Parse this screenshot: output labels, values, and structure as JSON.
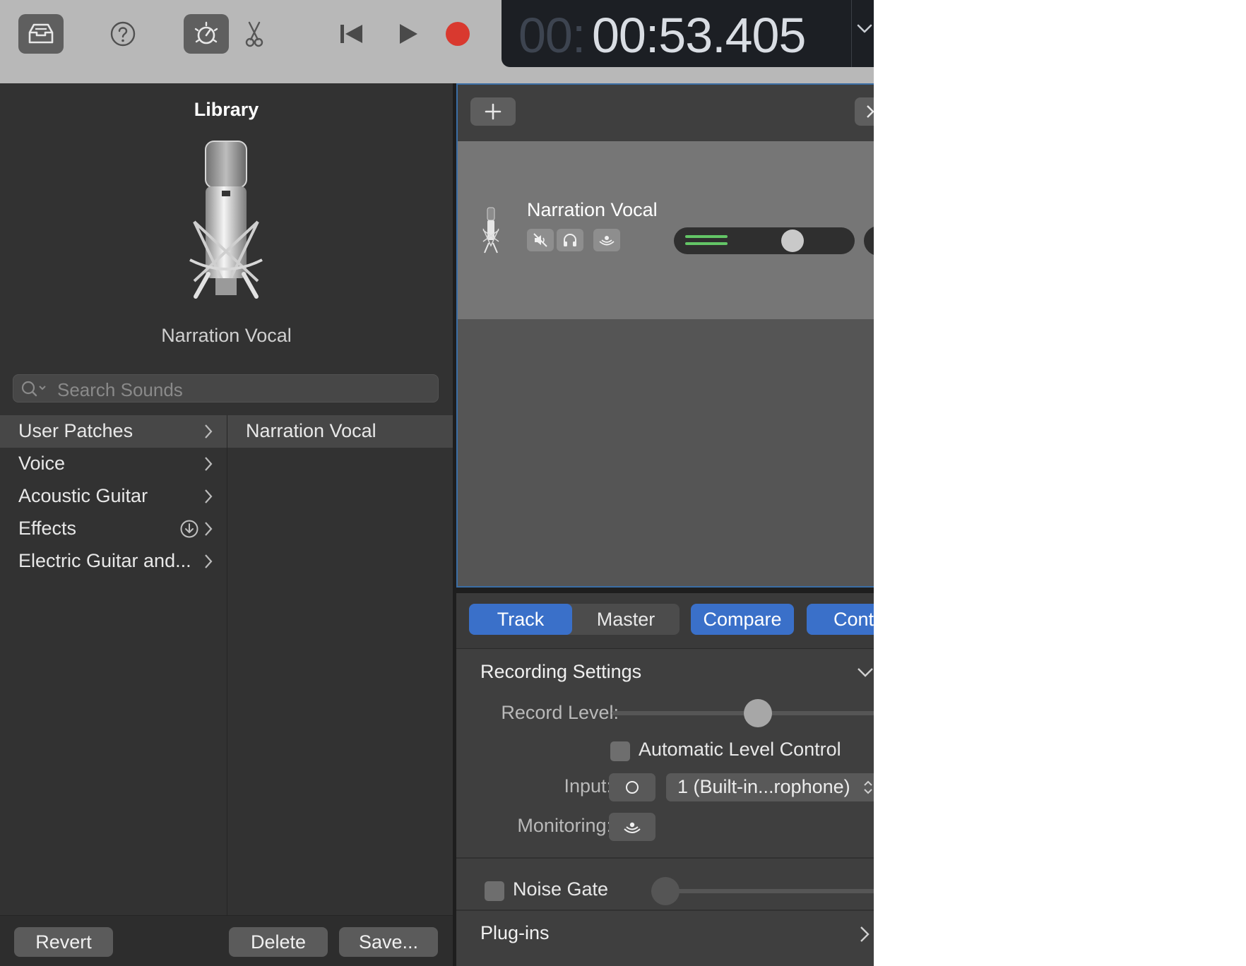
{
  "toolbar": {
    "icons": [
      "library-icon",
      "help-icon",
      "smart-controls-icon",
      "editors-scissors-icon",
      "rewind-icon",
      "play-icon",
      "record-icon"
    ],
    "lcd": {
      "time_dim": "00:",
      "time": "00:53.405"
    },
    "colors": {
      "record": "#d9392f",
      "lcd_bg": "#1c1f24"
    }
  },
  "library": {
    "title": "Library",
    "patch_name": "Narration Vocal",
    "search_placeholder": "Search Sounds",
    "categories": [
      {
        "label": "User Patches"
      },
      {
        "label": "Voice"
      },
      {
        "label": "Acoustic Guitar"
      },
      {
        "label": "Effects"
      },
      {
        "label": "Electric Guitar and..."
      }
    ],
    "patches": [
      {
        "label": "Narration Vocal"
      }
    ],
    "buttons": {
      "revert": "Revert",
      "delete": "Delete",
      "save": "Save..."
    }
  },
  "track": {
    "name": "Narration Vocal",
    "volume_fraction": 0.68
  },
  "smart_controls": {
    "tabs": {
      "track": "Track",
      "master": "Master"
    },
    "compare": "Compare",
    "controls": "Cont",
    "recording_settings": {
      "title": "Recording Settings",
      "record_level_label": "Record Level:",
      "record_level_fraction": 0.55,
      "auto_level_label": "Automatic Level Control",
      "input_label": "Input:",
      "input_value": "1  (Built-in...rophone)",
      "monitoring_label": "Monitoring:"
    },
    "noise_gate": {
      "label": "Noise Gate",
      "fraction": 0.0
    },
    "plugins": {
      "label": "Plug-ins"
    }
  },
  "accent": "#3a70c9"
}
